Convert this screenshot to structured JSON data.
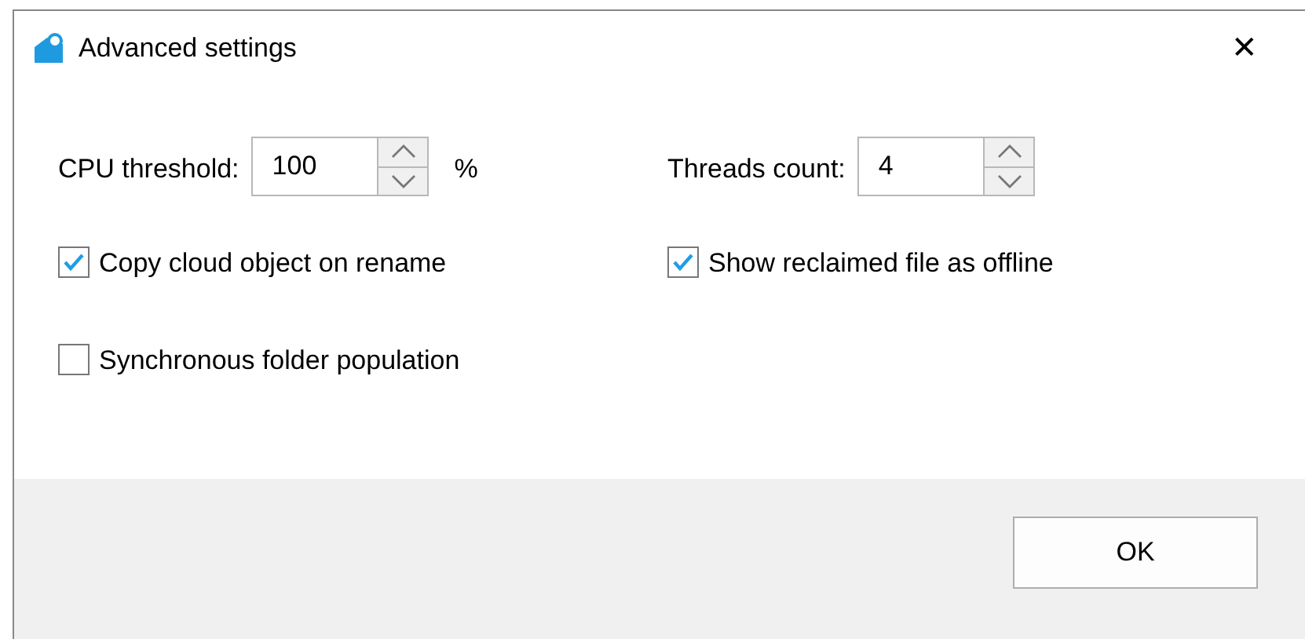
{
  "window": {
    "title": "Advanced settings",
    "close": "✕"
  },
  "spinners": [
    {
      "label": "CPU threshold:",
      "value": "100",
      "unit": "%"
    },
    {
      "label": "Threads count:",
      "value": "4"
    }
  ],
  "checkboxes": [
    {
      "label": "Copy cloud object on rename",
      "checked": true
    },
    {
      "label": "Show reclaimed file as offline",
      "checked": true
    },
    {
      "label": "Synchronous folder population",
      "checked": false
    }
  ],
  "buttons": [
    {
      "label": "OK"
    }
  ]
}
